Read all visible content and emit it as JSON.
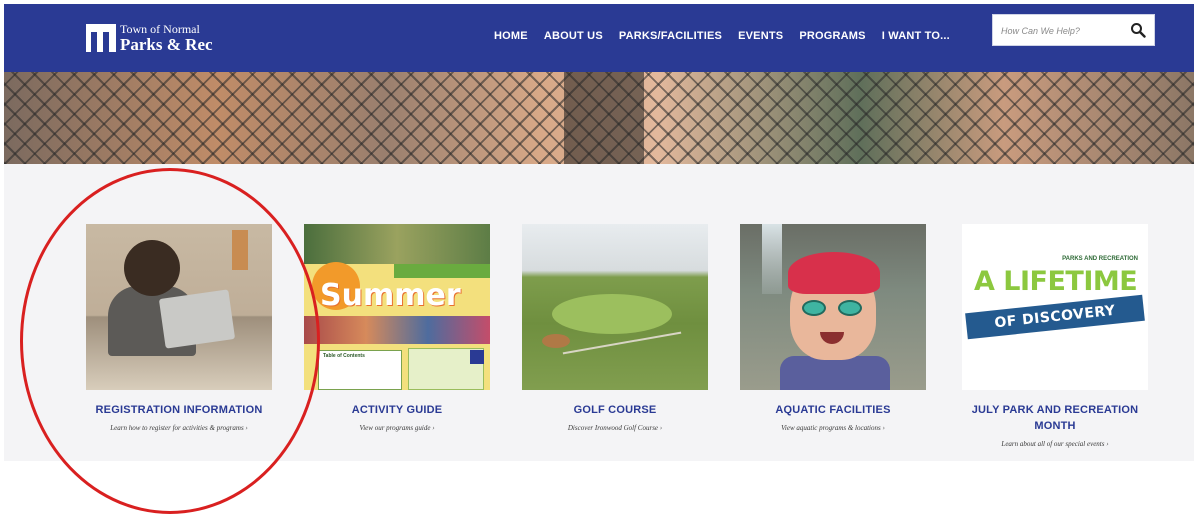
{
  "header": {
    "logo_line1": "Town of Normal",
    "logo_line2": "Parks & Rec",
    "nav": [
      "HOME",
      "ABOUT US",
      "PARKS/FACILITIES",
      "EVENTS",
      "PROGRAMS",
      "I WANT TO..."
    ],
    "search_placeholder": "How Can We Help?",
    "colors": {
      "header_bg": "#2a3a94",
      "accent": "#2a3a94"
    }
  },
  "cards": [
    {
      "title": "REGISTRATION INFORMATION",
      "link": "Learn how to register for activities & programs  ›"
    },
    {
      "title": "ACTIVITY GUIDE",
      "link": "View our programs guide  ›",
      "image_text": {
        "headline": "Summer",
        "toc": "Table of Contents"
      }
    },
    {
      "title": "GOLF COURSE",
      "link": "Discover Ironwood Golf Course  ›"
    },
    {
      "title": "AQUATIC FACILITIES",
      "link": "View aquatic programs & locations  ›"
    },
    {
      "title": "JULY PARK AND RECREATION MONTH",
      "link": "Learn about all of our special events  ›",
      "image_text": {
        "small": "PARKS AND RECREATION",
        "big": "A LIFETIME",
        "ribbon": "OF DISCOVERY"
      }
    }
  ],
  "annotation": {
    "color": "#d92020"
  }
}
